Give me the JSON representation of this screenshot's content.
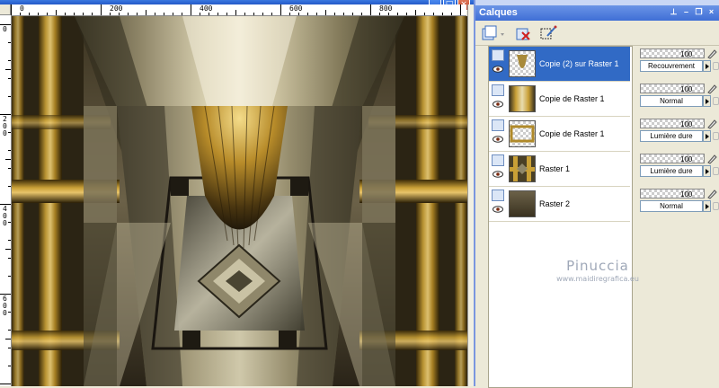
{
  "canvas": {
    "ruler_top_labels": [
      "0",
      "200",
      "400",
      "600",
      "800"
    ],
    "ruler_left_labels": [
      "0",
      "200",
      "400",
      "600"
    ]
  },
  "panel": {
    "title": "Calques",
    "controls": [
      "pin-icon",
      "minimize-icon",
      "restore-icon",
      "close-icon"
    ],
    "toolbar": [
      "new-layer-icon",
      "delete-layer-icon",
      "edit-selection-icon"
    ]
  },
  "layers": [
    {
      "name": "Copie (2) sur Raster 1",
      "opacity": "100",
      "blend": "Recouvrement",
      "selected": true
    },
    {
      "name": "Copie de Raster 1",
      "opacity": "100",
      "blend": "Normal",
      "selected": false
    },
    {
      "name": "Copie de Raster 1",
      "opacity": "100",
      "blend": "Lumière dure",
      "selected": false
    },
    {
      "name": "Raster 1",
      "opacity": "100",
      "blend": "Lumière dure",
      "selected": false
    },
    {
      "name": "Raster 2",
      "opacity": "100",
      "blend": "Normal",
      "selected": false
    }
  ],
  "watermark": {
    "name": "Pinuccia",
    "url": "www.maidiregrafica.eu"
  },
  "colors": {
    "accent": "#316ac5",
    "titlebar": "#3f6fd6",
    "art_gold": "#c9a036",
    "art_dark": "#1e1a12"
  }
}
